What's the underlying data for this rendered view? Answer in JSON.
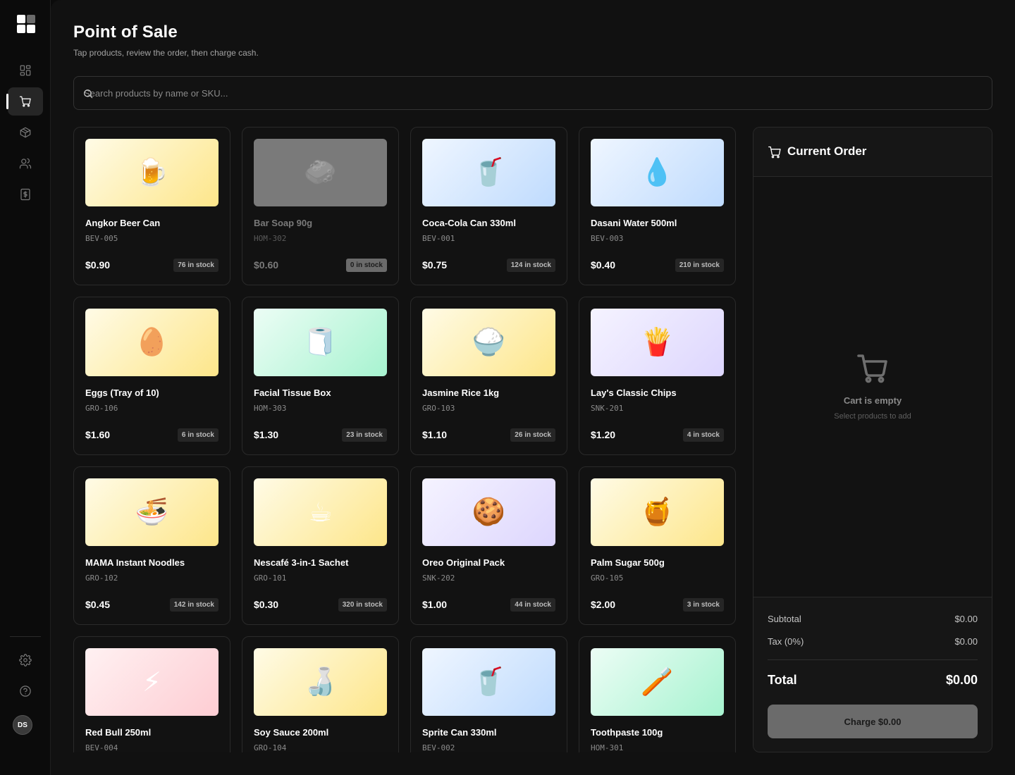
{
  "user": {
    "initials": "DS"
  },
  "page": {
    "title": "Point of Sale",
    "subtitle": "Tap products, review the order, then charge cash."
  },
  "search": {
    "placeholder": "Search products by name or SKU..."
  },
  "products": [
    {
      "name": "Angkor Beer Can",
      "sku": "BEV-005",
      "price": "$0.90",
      "stock": "76 in stock",
      "emoji": "🍺",
      "bg": "yellow",
      "out_of_stock": false
    },
    {
      "name": "Bar Soap 90g",
      "sku": "HOM-302",
      "price": "$0.60",
      "stock": "0 in stock",
      "emoji": "🧼",
      "bg": "gray",
      "out_of_stock": true
    },
    {
      "name": "Coca-Cola Can 330ml",
      "sku": "BEV-001",
      "price": "$0.75",
      "stock": "124 in stock",
      "emoji": "🥤",
      "bg": "blue",
      "out_of_stock": false
    },
    {
      "name": "Dasani Water 500ml",
      "sku": "BEV-003",
      "price": "$0.40",
      "stock": "210 in stock",
      "emoji": "💧",
      "bg": "blue",
      "out_of_stock": false
    },
    {
      "name": "Eggs (Tray of 10)",
      "sku": "GRO-106",
      "price": "$1.60",
      "stock": "6 in stock",
      "emoji": "🥚",
      "bg": "yellow",
      "out_of_stock": false
    },
    {
      "name": "Facial Tissue Box",
      "sku": "HOM-303",
      "price": "$1.30",
      "stock": "23 in stock",
      "emoji": "🧻",
      "bg": "green",
      "out_of_stock": false
    },
    {
      "name": "Jasmine Rice 1kg",
      "sku": "GRO-103",
      "price": "$1.10",
      "stock": "26 in stock",
      "emoji": "🍚",
      "bg": "yellow",
      "out_of_stock": false
    },
    {
      "name": "Lay's Classic Chips",
      "sku": "SNK-201",
      "price": "$1.20",
      "stock": "4 in stock",
      "emoji": "🍟",
      "bg": "purple",
      "out_of_stock": false
    },
    {
      "name": "MAMA Instant Noodles",
      "sku": "GRO-102",
      "price": "$0.45",
      "stock": "142 in stock",
      "emoji": "🍜",
      "bg": "yellow",
      "out_of_stock": false
    },
    {
      "name": "Nescafé 3-in-1 Sachet",
      "sku": "GRO-101",
      "price": "$0.30",
      "stock": "320 in stock",
      "emoji": "☕",
      "bg": "yellow",
      "out_of_stock": false
    },
    {
      "name": "Oreo Original Pack",
      "sku": "SNK-202",
      "price": "$1.00",
      "stock": "44 in stock",
      "emoji": "🍪",
      "bg": "purple",
      "out_of_stock": false
    },
    {
      "name": "Palm Sugar 500g",
      "sku": "GRO-105",
      "price": "$2.00",
      "stock": "3 in stock",
      "emoji": "🍯",
      "bg": "yellow",
      "out_of_stock": false
    },
    {
      "name": "Red Bull 250ml",
      "sku": "BEV-004",
      "price": "",
      "stock": "",
      "emoji": "⚡",
      "bg": "pink",
      "out_of_stock": false
    },
    {
      "name": "Soy Sauce 200ml",
      "sku": "GRO-104",
      "price": "",
      "stock": "",
      "emoji": "🍶",
      "bg": "yellow",
      "out_of_stock": false
    },
    {
      "name": "Sprite Can 330ml",
      "sku": "BEV-002",
      "price": "",
      "stock": "",
      "emoji": "🥤",
      "bg": "blue",
      "out_of_stock": false
    },
    {
      "name": "Toothpaste 100g",
      "sku": "HOM-301",
      "price": "",
      "stock": "",
      "emoji": "🪥",
      "bg": "green",
      "out_of_stock": false
    }
  ],
  "order": {
    "title": "Current Order",
    "empty_title": "Cart is empty",
    "empty_subtitle": "Select products to add",
    "subtotal_label": "Subtotal",
    "subtotal_value": "$0.00",
    "tax_label": "Tax (0%)",
    "tax_value": "$0.00",
    "total_label": "Total",
    "total_value": "$0.00",
    "charge_label": "Charge $0.00"
  },
  "colors": {
    "background": "#111111",
    "rail": "#0b0b0b",
    "card_border": "#2a2a2a",
    "disabled_button": "#6b6b6b"
  }
}
